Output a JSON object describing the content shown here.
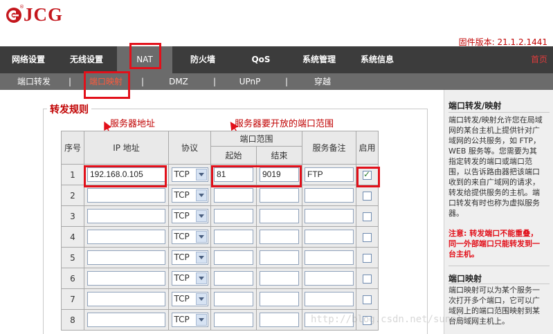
{
  "logo": {
    "text": "JCG",
    "reg": "®"
  },
  "firmware": "固件版本: 21.1.2.1441",
  "nav": {
    "items": [
      "网络设置",
      "无线设置",
      "NAT",
      "防火墙",
      "QoS",
      "系统管理",
      "系统信息"
    ],
    "home": "首页"
  },
  "subnav": {
    "items": [
      "端口转发",
      "端口映射",
      "DMZ",
      "UPnP",
      "穿越"
    ],
    "sep": "|"
  },
  "legend": "转发规则",
  "annotations": {
    "server_addr": "服务器地址",
    "port_range": "服务器要开放的端口范围"
  },
  "table": {
    "headers": {
      "idx": "序号",
      "ip": "IP 地址",
      "proto": "协议",
      "range": "端口范围",
      "start": "起始",
      "end": "结束",
      "note": "服务备注",
      "enable": "启用"
    },
    "rows": [
      {
        "idx": "1",
        "ip": "192.168.0.105",
        "proto": "TCP",
        "start": "81",
        "end": "9019",
        "note": "FTP",
        "enabled": true
      },
      {
        "idx": "2",
        "ip": "",
        "proto": "TCP",
        "start": "",
        "end": "",
        "note": "",
        "enabled": false
      },
      {
        "idx": "3",
        "ip": "",
        "proto": "TCP",
        "start": "",
        "end": "",
        "note": "",
        "enabled": false
      },
      {
        "idx": "4",
        "ip": "",
        "proto": "TCP",
        "start": "",
        "end": "",
        "note": "",
        "enabled": false
      },
      {
        "idx": "5",
        "ip": "",
        "proto": "TCP",
        "start": "",
        "end": "",
        "note": "",
        "enabled": false
      },
      {
        "idx": "6",
        "ip": "",
        "proto": "TCP",
        "start": "",
        "end": "",
        "note": "",
        "enabled": false
      },
      {
        "idx": "7",
        "ip": "",
        "proto": "TCP",
        "start": "",
        "end": "",
        "note": "",
        "enabled": false
      },
      {
        "idx": "8",
        "ip": "",
        "proto": "TCP",
        "start": "",
        "end": "",
        "note": "",
        "enabled": false
      }
    ]
  },
  "sidebar": {
    "forward_title": "端口转发/映射",
    "forward_lines": [
      "端口转发/映射允许您在局域",
      "网的某台主机上提供针对广",
      "域网的公共服务，如 FTP，",
      "WEB 服务等。您需要为其",
      "指定转发的端口或端口范",
      "围，以告诉路由器把该端口",
      "收到的来自广域网的请求，",
      "转发给提供服务的主机。端",
      "口转发有时也称为虚拟服务",
      "器。"
    ],
    "note_lines": [
      "注意: 转发端口不能重叠，",
      "同一外部端口只能转发到一",
      "台主机。"
    ],
    "map_title": "端口映射",
    "map_lines": [
      "端口映射可以为某个服务一",
      "次打开多个端口，它可以广",
      "域网上的端口范围映射到某",
      "台局域网主机上。"
    ]
  },
  "watermark": "http://blog.csdn.net/sunology"
}
